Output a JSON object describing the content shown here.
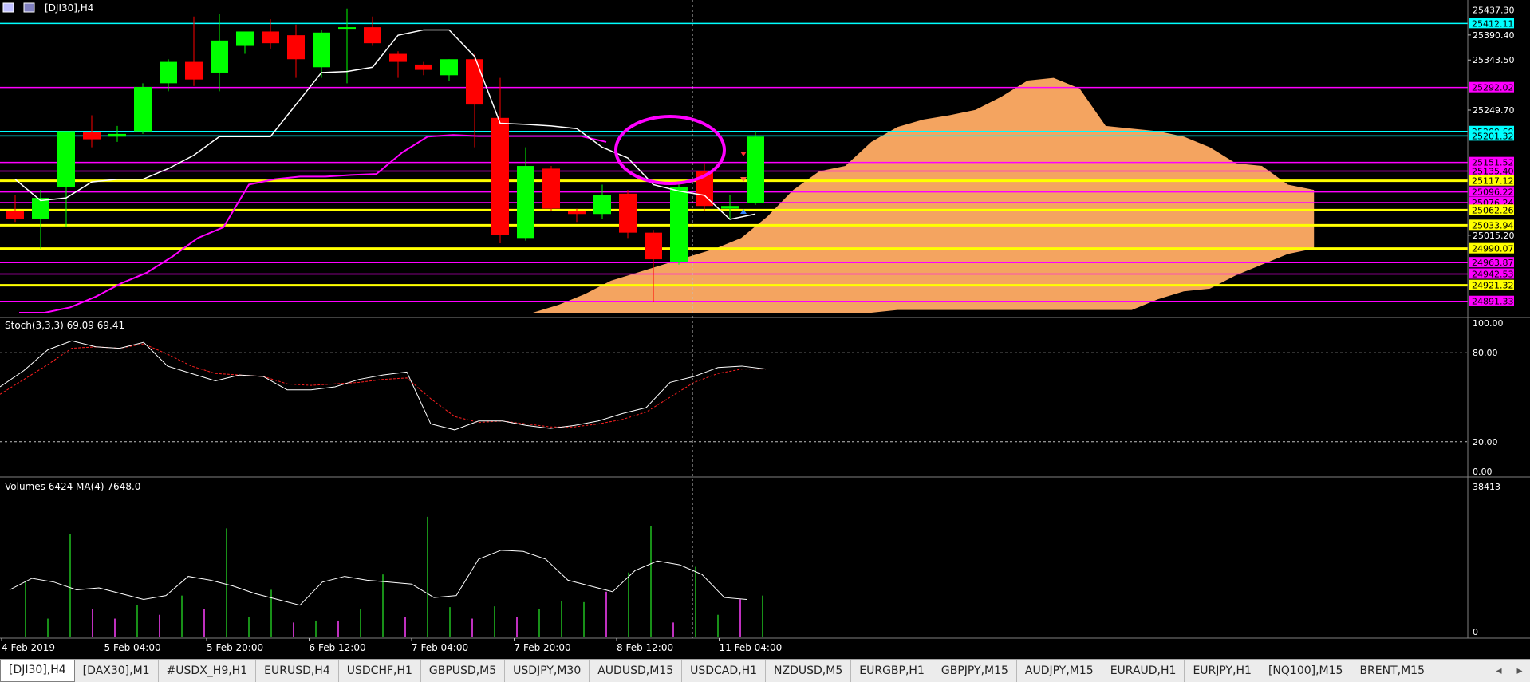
{
  "window": {
    "title": "[DJI30],H4",
    "icon_names": [
      "chart-window-icon",
      "restore-icon"
    ]
  },
  "colors": {
    "bull": "#00ff00",
    "bear": "#ff0000",
    "cloud": "#f4a460",
    "magenta": "#ff00ff",
    "yellow": "#ffff00",
    "cyan": "#00ffff",
    "white": "#ffffff"
  },
  "price_axis": {
    "ticks": [
      "25437.30",
      "25390.40",
      "25343.50",
      "25249.70",
      "25015.20"
    ],
    "level_labels": [
      {
        "text": "25412.11",
        "price": 25412.11,
        "color": "cyan"
      },
      {
        "text": "25292.02",
        "price": 25292.02,
        "color": "magenta"
      },
      {
        "text": "25209.69",
        "price": 25209.69,
        "color": "cyan"
      },
      {
        "text": "25201.32",
        "price": 25201.32,
        "color": "cyan"
      },
      {
        "text": "25151.52",
        "price": 25151.52,
        "color": "magenta"
      },
      {
        "text": "25135.40",
        "price": 25135.4,
        "color": "magenta"
      },
      {
        "text": "25117.12",
        "price": 25117.12,
        "color": "yellow"
      },
      {
        "text": "25096.22",
        "price": 25096.22,
        "color": "magenta"
      },
      {
        "text": "25076.24",
        "price": 25076.24,
        "color": "magenta"
      },
      {
        "text": "25062.26",
        "price": 25062.26,
        "color": "yellow"
      },
      {
        "text": "25033.94",
        "price": 25033.94,
        "color": "yellow"
      },
      {
        "text": "24990.07",
        "price": 24990.07,
        "color": "yellow"
      },
      {
        "text": "24963.87",
        "price": 24963.87,
        "color": "magenta"
      },
      {
        "text": "24942.53",
        "price": 24942.53,
        "color": "magenta"
      },
      {
        "text": "24921.32",
        "price": 24921.32,
        "color": "yellow"
      },
      {
        "text": "24891.33",
        "price": 24891.33,
        "color": "magenta"
      }
    ]
  },
  "stoch_panel": {
    "label": "Stoch(3,3,3) 69.09 69.41",
    "ticks": [
      "100.00",
      "80.00",
      "20.00",
      "0.00"
    ]
  },
  "volume_panel": {
    "label": "Volumes 6424 MA(4) 7648.0",
    "ticks": [
      "38413",
      "0"
    ]
  },
  "time_axis": {
    "labels": [
      "4 Feb 2019",
      "5 Feb 04:00",
      "5 Feb 20:00",
      "6 Feb 12:00",
      "7 Feb 04:00",
      "7 Feb 20:00",
      "8 Feb 12:00",
      "11 Feb 04:00"
    ]
  },
  "chart_data": {
    "type": "candlestick",
    "symbol": "DJI30",
    "timeframe": "H4",
    "ylim": [
      24870,
      25450
    ],
    "candles": [
      {
        "o": 25060,
        "h": 25090,
        "l": 25040,
        "c": 25045
      },
      {
        "o": 25045,
        "h": 25100,
        "l": 24990,
        "c": 25085
      },
      {
        "o": 25105,
        "h": 25200,
        "l": 25030,
        "c": 25210
      },
      {
        "o": 25208,
        "h": 25240,
        "l": 25180,
        "c": 25195
      },
      {
        "o": 25200,
        "h": 25220,
        "l": 25190,
        "c": 25205
      },
      {
        "o": 25210,
        "h": 25300,
        "l": 25205,
        "c": 25293
      },
      {
        "o": 25300,
        "h": 25345,
        "l": 25285,
        "c": 25340
      },
      {
        "o": 25340,
        "h": 25425,
        "l": 25295,
        "c": 25307
      },
      {
        "o": 25320,
        "h": 25430,
        "l": 25285,
        "c": 25380
      },
      {
        "o": 25370,
        "h": 25392,
        "l": 25355,
        "c": 25397
      },
      {
        "o": 25397,
        "h": 25420,
        "l": 25365,
        "c": 25375
      },
      {
        "o": 25390,
        "h": 25410,
        "l": 25310,
        "c": 25345
      },
      {
        "o": 25330,
        "h": 25400,
        "l": 25310,
        "c": 25395
      },
      {
        "o": 25403,
        "h": 25440,
        "l": 25300,
        "c": 25405
      },
      {
        "o": 25405,
        "h": 25425,
        "l": 25370,
        "c": 25375
      },
      {
        "o": 25355,
        "h": 25360,
        "l": 25310,
        "c": 25340
      },
      {
        "o": 25335,
        "h": 25340,
        "l": 25315,
        "c": 25325
      },
      {
        "o": 25315,
        "h": 25345,
        "l": 25305,
        "c": 25345
      },
      {
        "o": 25345,
        "h": 25355,
        "l": 25180,
        "c": 25260
      },
      {
        "o": 25235,
        "h": 25310,
        "l": 25000,
        "c": 25015
      },
      {
        "o": 25010,
        "h": 25180,
        "l": 25005,
        "c": 25145
      },
      {
        "o": 25140,
        "h": 25145,
        "l": 25060,
        "c": 25065
      },
      {
        "o": 25060,
        "h": 25065,
        "l": 25040,
        "c": 25055
      },
      {
        "o": 25055,
        "h": 25110,
        "l": 25045,
        "c": 25090
      },
      {
        "o": 25093,
        "h": 25100,
        "l": 25010,
        "c": 25020
      },
      {
        "o": 25020,
        "h": 25025,
        "l": 24890,
        "c": 24970
      },
      {
        "o": 24965,
        "h": 25115,
        "l": 24960,
        "c": 25105
      },
      {
        "o": 25135,
        "h": 25150,
        "l": 25060,
        "c": 25070
      },
      {
        "o": 25065,
        "h": 25090,
        "l": 25045,
        "c": 25070
      },
      {
        "o": 25075,
        "h": 25210,
        "l": 25072,
        "c": 25200
      }
    ],
    "ma_white": [
      25120,
      25080,
      25085,
      25115,
      25120,
      25120,
      25140,
      25165,
      25200,
      25200,
      25200,
      25260,
      25320,
      25322,
      25330,
      25390,
      25400,
      25400,
      25350,
      25225,
      25223,
      25220,
      25215,
      25180,
      25160,
      25110,
      25098,
      25090,
      25045,
      25055
    ],
    "ma_magenta": [
      24870,
      24870,
      24880,
      24900,
      24925,
      24945,
      24975,
      25010,
      25030,
      25110,
      25120,
      25125,
      25125,
      25128,
      25130,
      25170,
      25200,
      25203,
      25201,
      25201,
      25201,
      25201,
      25201,
      25190
    ],
    "cloud_top": [
      24870,
      24885,
      24905,
      24930,
      24945,
      24960,
      24975,
      24990,
      25010,
      25050,
      25100,
      25135,
      25145,
      25190,
      25218,
      25232,
      25240,
      25250,
      25275,
      25305,
      25310,
      25290,
      25220,
      25215,
      25210,
      25200,
      25180,
      25150,
      25145,
      25110,
      25100
    ],
    "cloud_bottom": [
      24870,
      24870,
      24870,
      24870,
      24870,
      24870,
      24870,
      24870,
      24870,
      24870,
      24870,
      24870,
      24870,
      24870,
      24875,
      24875,
      24875,
      24875,
      24875,
      24875,
      24875,
      24875,
      24875,
      24875,
      24895,
      24910,
      24915,
      24940,
      24960,
      24980,
      24990
    ],
    "stoch_main": [
      57,
      68,
      82,
      88,
      84,
      83,
      87,
      71,
      66,
      61,
      65,
      64,
      55,
      55,
      57,
      62,
      65,
      67,
      32,
      28,
      34,
      34,
      31,
      29,
      31,
      34,
      39,
      43,
      60,
      64,
      70,
      71,
      69
    ],
    "stoch_signal": [
      52,
      62,
      72,
      83,
      84,
      83,
      86,
      79,
      71,
      66,
      65,
      64,
      59,
      58,
      59,
      60,
      62,
      63,
      49,
      37,
      33,
      34,
      32,
      30,
      30,
      32,
      35,
      40,
      50,
      60,
      66,
      69,
      69
    ],
    "volumes": [
      12500,
      3000,
      25000,
      5500,
      3000,
      6500,
      4000,
      9000,
      5500,
      26500,
      3500,
      10500,
      2000,
      2500,
      2500,
      5500,
      14500,
      3500,
      29500,
      6000,
      3000,
      6200,
      3500,
      5500,
      7500,
      7300,
      10000,
      15000,
      27000,
      2000,
      16500,
      4000,
      8000,
      9000
    ],
    "volume_colors": [
      0,
      0,
      0,
      1,
      1,
      0,
      1,
      0,
      1,
      0,
      0,
      0,
      1,
      0,
      1,
      0,
      0,
      1,
      0,
      0,
      1,
      0,
      1,
      0,
      0,
      0,
      1,
      0,
      0,
      1,
      0,
      0,
      1,
      0
    ],
    "volume_ma": [
      10500,
      13500,
      12500,
      10500,
      11000,
      9500,
      8000,
      9000,
      14000,
      13000,
      11500,
      9500,
      8000,
      6500,
      12500,
      14000,
      13000,
      12500,
      12000,
      8500,
      9000,
      18500,
      20800,
      20500,
      18500,
      13000,
      11500,
      10000,
      15500,
      18000,
      17000,
      14500,
      8500,
      8000
    ],
    "ylim_stoch": [
      0,
      100
    ],
    "ylim_volume": [
      0,
      38413
    ]
  },
  "tabs": [
    {
      "label": "[DJI30],H4",
      "active": true
    },
    {
      "label": "[DAX30],M1"
    },
    {
      "label": "#USDX_H9,H1"
    },
    {
      "label": "EURUSD,H4"
    },
    {
      "label": "USDCHF,H1"
    },
    {
      "label": "GBPUSD,M5"
    },
    {
      "label": "USDJPY,M30"
    },
    {
      "label": "AUDUSD,M15"
    },
    {
      "label": "USDCAD,H1"
    },
    {
      "label": "NZDUSD,M5"
    },
    {
      "label": "EURGBP,H1"
    },
    {
      "label": "GBPJPY,M15"
    },
    {
      "label": "AUDJPY,M15"
    },
    {
      "label": "EURAUD,H1"
    },
    {
      "label": "EURJPY,H1"
    },
    {
      "label": "[NQ100],M15"
    },
    {
      "label": "BRENT,M15"
    }
  ],
  "tab_scroll": {
    "left": "◂",
    "right": "▸"
  }
}
